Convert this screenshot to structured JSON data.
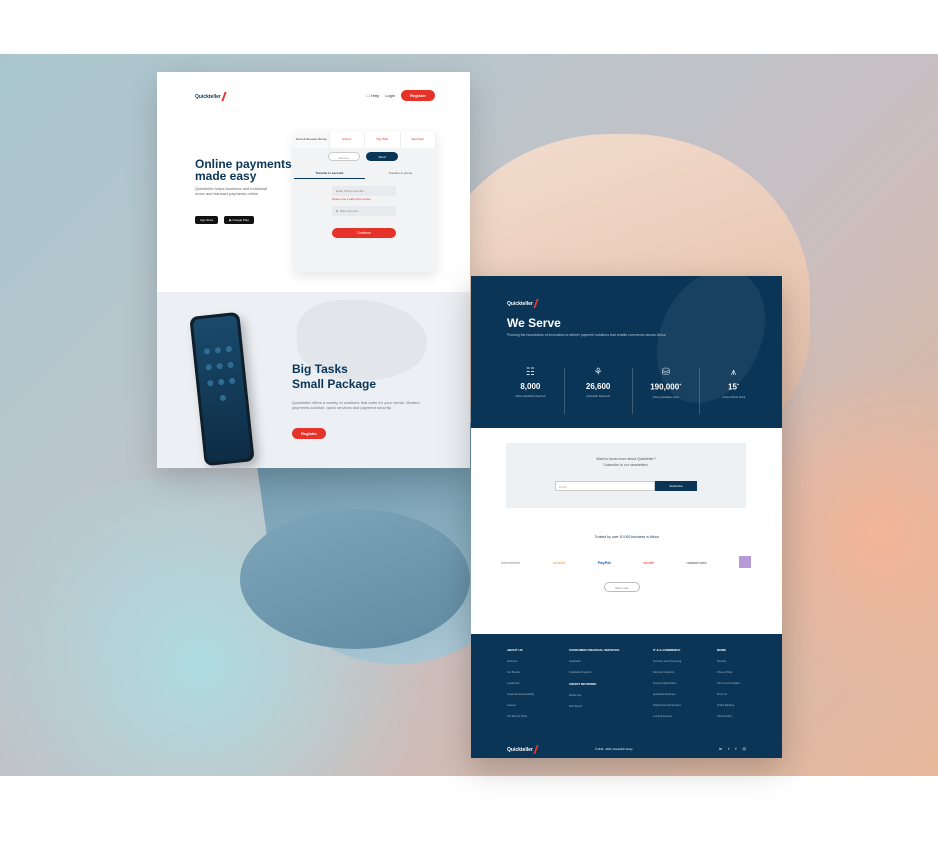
{
  "left_page": {
    "brand": "Quickteller",
    "nav": {
      "help": "Help",
      "login": "Login",
      "register": "Register"
    },
    "hero_title": "Online payments made easy",
    "hero_sub": "Quickteller helps business and individual move and transact payments online",
    "stores": [
      "App Store",
      "Google Play"
    ],
    "pay_tabs": [
      "Send & Receive Money",
      "Airtime",
      "Pay Bills",
      "Merchant"
    ],
    "toggle": {
      "receive": "Receive",
      "send": "Send"
    },
    "subtabs": [
      "Transfer to account",
      "Transfer to phone"
    ],
    "field_phone": "Enter Phone Number",
    "field_error": "Please enter a valid phone number",
    "field_amount": "Enter Amount",
    "amount_prefix": "₦",
    "continue": "Continue",
    "bottom_title_1": "Big Tasks",
    "bottom_title_2": "Small Package",
    "bottom_sub": "Quickteller offers a variety of solutions that cater for your needs. Modern payments solution, quick services and payment security.",
    "bottom_cta": "Register"
  },
  "right_page": {
    "brand": "Quickteller",
    "title": "We Serve",
    "sub": "Pushing the boundaries of innovation to deliver payment solutions that enable commerce across Africa",
    "stats": [
      {
        "icon": "users-icon",
        "glyph": "☷",
        "num": "8,000",
        "label": "Active Quickteller Payment"
      },
      {
        "icon": "coins-icon",
        "glyph": "⚘",
        "num": "26,600",
        "label": "Quickteller Payments"
      },
      {
        "icon": "database-icon",
        "glyph": "⛁",
        "num": "190,000",
        "label": "Active Quickteller Users"
      },
      {
        "icon": "compass-icon",
        "glyph": "⩚",
        "num": "15",
        "label": "Across African Africa"
      }
    ],
    "subscribe_q": "Want to know more about Quickteller?",
    "subscribe_s": "Subscribe to our newsletters.",
    "email_placeholder": "Email",
    "subscribe_btn": "Subscribe",
    "trusted": "Trusted by over 10,000 business in Africa",
    "logos": [
      "Interswitch",
      "access",
      "PayPal",
      "zenith",
      "mastercard",
      ""
    ],
    "view_more": "View more",
    "footer": {
      "cols": [
        {
          "h": "ABOUT US",
          "items": [
            "About Us",
            "Our Brands",
            "Leadership",
            "Corporate Responsibility",
            "Careers",
            "Our Story & Policy"
          ]
        },
        {
          "h": "CONSUMER FINANCIAL SERVICES",
          "items": [
            "Quickteller",
            "Quickteller Paypoint",
            "CREDIT NETWORK",
            "Mobile App",
            "Web Report"
          ]
        },
        {
          "h": "IT & E-COMMERCE",
          "items": [
            "Inventory and Processing",
            "Payment Collection",
            "Account Optimization",
            "Quickteller Business",
            "Digital Financial Services",
            "Lending Services"
          ]
        },
        {
          "h": "MORE",
          "items": [
            "Security",
            "Privacy Policy",
            "Terms and Condition",
            "Press Kit",
            "Online Banking",
            "Cookie Policy"
          ]
        }
      ],
      "copyright": "© 2019 - 2020 | Interswitch Group",
      "socials": [
        "in",
        "t",
        "f",
        "◎"
      ]
    }
  }
}
